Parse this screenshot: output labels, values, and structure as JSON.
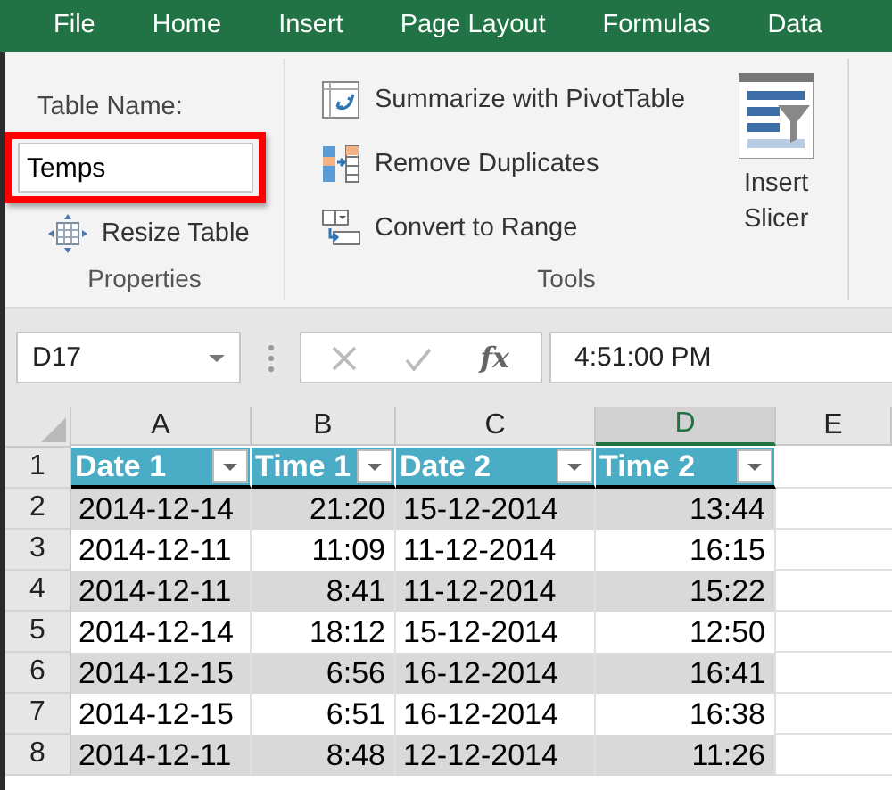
{
  "tabs": [
    {
      "label": "File"
    },
    {
      "label": "Home"
    },
    {
      "label": "Insert"
    },
    {
      "label": "Page Layout"
    },
    {
      "label": "Formulas"
    },
    {
      "label": "Data"
    }
  ],
  "ribbon": {
    "properties": {
      "table_name_label": "Table Name:",
      "table_name": "Temps",
      "highlighted": true,
      "resize_button": "Resize Table",
      "label": "Properties"
    },
    "tools": {
      "buttons": [
        {
          "kind": "pivot",
          "label": "Summarize with PivotTable"
        },
        {
          "kind": "duplicates",
          "label": "Remove Duplicates"
        },
        {
          "kind": "convert",
          "label": "Convert to Range"
        }
      ],
      "slicer_button": "Insert Slicer",
      "label": "Tools"
    }
  },
  "formula_bar": {
    "name_box": "D17",
    "function_label": "fx",
    "formula": "4:51:00 PM"
  },
  "sheet": {
    "columns": [
      {
        "label": "A",
        "selected": false
      },
      {
        "label": "B",
        "selected": false
      },
      {
        "label": "C",
        "selected": false
      },
      {
        "label": "D",
        "selected": true
      },
      {
        "label": "E",
        "selected": false
      }
    ],
    "header_row": {
      "number": "1",
      "cells": [
        "Date 1",
        "Time 1",
        "Date 2",
        "Time 2"
      ]
    },
    "rows": [
      {
        "number": "2",
        "cells": [
          "2014-12-14",
          "21:20",
          "15-12-2014",
          "13:44"
        ]
      },
      {
        "number": "3",
        "cells": [
          "2014-12-11",
          "11:09",
          "11-12-2014",
          "16:15"
        ]
      },
      {
        "number": "4",
        "cells": [
          "2014-12-11",
          "8:41",
          "11-12-2014",
          "15:22"
        ]
      },
      {
        "number": "5",
        "cells": [
          "2014-12-14",
          "18:12",
          "15-12-2014",
          "12:50"
        ]
      },
      {
        "number": "6",
        "cells": [
          "2014-12-15",
          "6:56",
          "16-12-2014",
          "16:41"
        ]
      },
      {
        "number": "7",
        "cells": [
          "2014-12-15",
          "6:51",
          "16-12-2014",
          "16:38"
        ]
      },
      {
        "number": "8",
        "cells": [
          "2014-12-11",
          "8:48",
          "12-12-2014",
          "11:26"
        ]
      }
    ]
  }
}
